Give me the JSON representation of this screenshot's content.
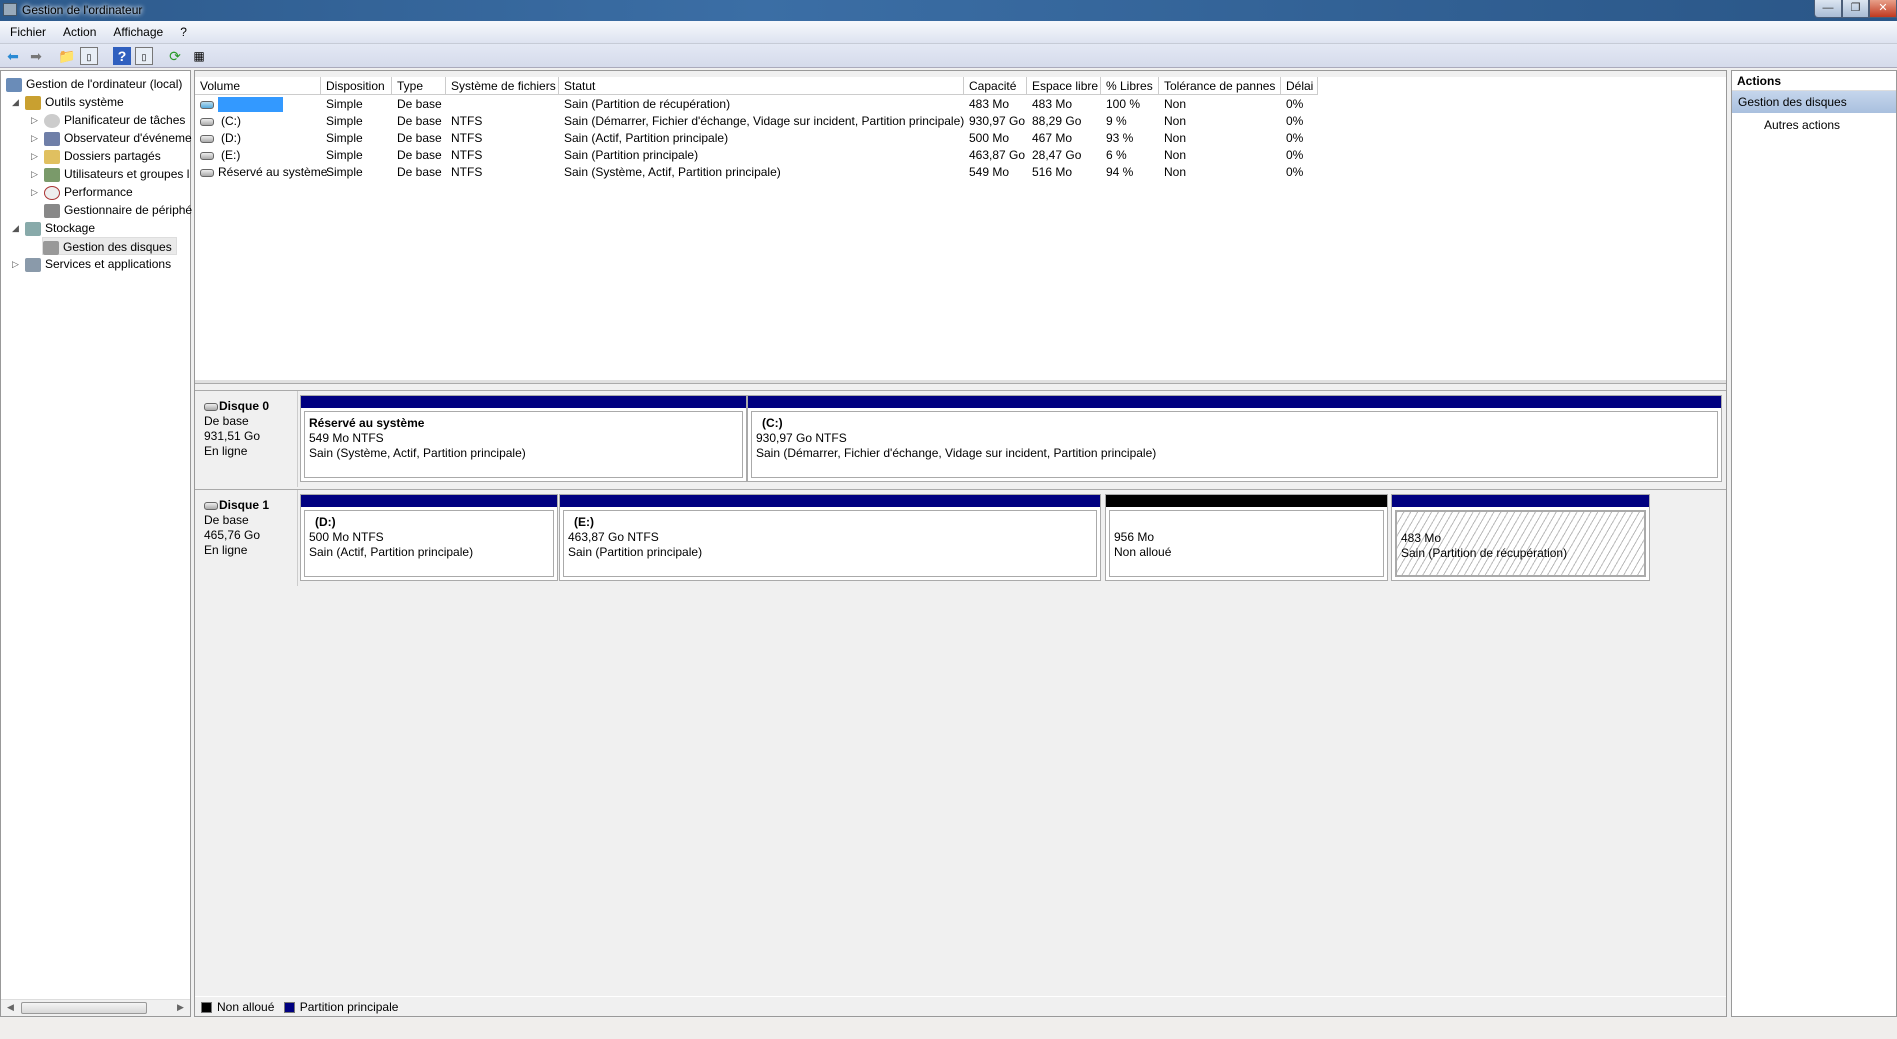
{
  "window": {
    "title": "Gestion de l'ordinateur",
    "controls": [
      "minimize",
      "restore",
      "close"
    ]
  },
  "menu": [
    "Fichier",
    "Action",
    "Affichage",
    "?"
  ],
  "toolbar": [
    "back-icon",
    "forward-icon",
    "up-folder-icon",
    "show-hide-tree-icon",
    "help-icon",
    "show-hide-action-icon",
    "refresh-icon",
    "properties-icon"
  ],
  "tree": {
    "root": "Gestion de l'ordinateur (local)",
    "tools": "Outils système",
    "tools_items": [
      "Planificateur de tâches",
      "Observateur d'événeme",
      "Dossiers partagés",
      "Utilisateurs et groupes l",
      "Performance",
      "Gestionnaire de périphé"
    ],
    "storage": "Stockage",
    "storage_items": [
      "Gestion des disques"
    ],
    "services": "Services et applications"
  },
  "table": {
    "columns": [
      "Volume",
      "Disposition",
      "Type",
      "Système de fichiers",
      "Statut",
      "Capacité",
      "Espace libre",
      "% Libres",
      "Tolérance de pannes",
      "Délai"
    ],
    "rows": [
      [
        "",
        "Simple",
        "De base",
        "",
        "Sain (Partition de récupération)",
        "483 Mo",
        "483 Mo",
        "100 %",
        "Non",
        "0%"
      ],
      [
        "(C:)",
        "Simple",
        "De base",
        "NTFS",
        "Sain (Démarrer, Fichier d'échange, Vidage sur incident, Partition principale)",
        "930,97 Go",
        "88,29 Go",
        "9 %",
        "Non",
        "0%"
      ],
      [
        "(D:)",
        "Simple",
        "De base",
        "NTFS",
        "Sain (Actif, Partition principale)",
        "500 Mo",
        "467 Mo",
        "93 %",
        "Non",
        "0%"
      ],
      [
        "(E:)",
        "Simple",
        "De base",
        "NTFS",
        "Sain (Partition principale)",
        "463,87 Go",
        "28,47 Go",
        "6 %",
        "Non",
        "0%"
      ],
      [
        "Réservé au système",
        "Simple",
        "De base",
        "NTFS",
        "Sain (Système, Actif, Partition principale)",
        "549 Mo",
        "516 Mo",
        "94 %",
        "Non",
        "0%"
      ]
    ]
  },
  "disks": [
    {
      "name": "Disque 0",
      "type": "De base",
      "size": "931,51 Go",
      "state": "En ligne",
      "partitions": [
        {
          "title": "Réservé au système",
          "size": "549 Mo NTFS",
          "status": "Sain (Système, Actif, Partition principale)"
        },
        {
          "title": "(C:)",
          "size": "930,97 Go NTFS",
          "status": "Sain (Démarrer, Fichier d'échange, Vidage sur incident, Partition principale)"
        }
      ]
    },
    {
      "name": "Disque 1",
      "type": "De base",
      "size": "465,76 Go",
      "state": "En ligne",
      "partitions": [
        {
          "title": "(D:)",
          "size": "500 Mo NTFS",
          "status": "Sain (Actif, Partition principale)"
        },
        {
          "title": "(E:)",
          "size": "463,87 Go NTFS",
          "status": "Sain (Partition principale)"
        },
        {
          "title": "",
          "size": "956 Mo",
          "status": "Non alloué"
        },
        {
          "title": "",
          "size": "483 Mo",
          "status": "Sain (Partition de récupération)"
        }
      ]
    }
  ],
  "legend": [
    "Non alloué",
    "Partition principale"
  ],
  "colors": {
    "primary": "#000080",
    "unallocated": "#000000",
    "selection": "#3399ff"
  },
  "actions": {
    "header": "Actions",
    "section": "Gestion des disques",
    "item": "Autres actions"
  }
}
